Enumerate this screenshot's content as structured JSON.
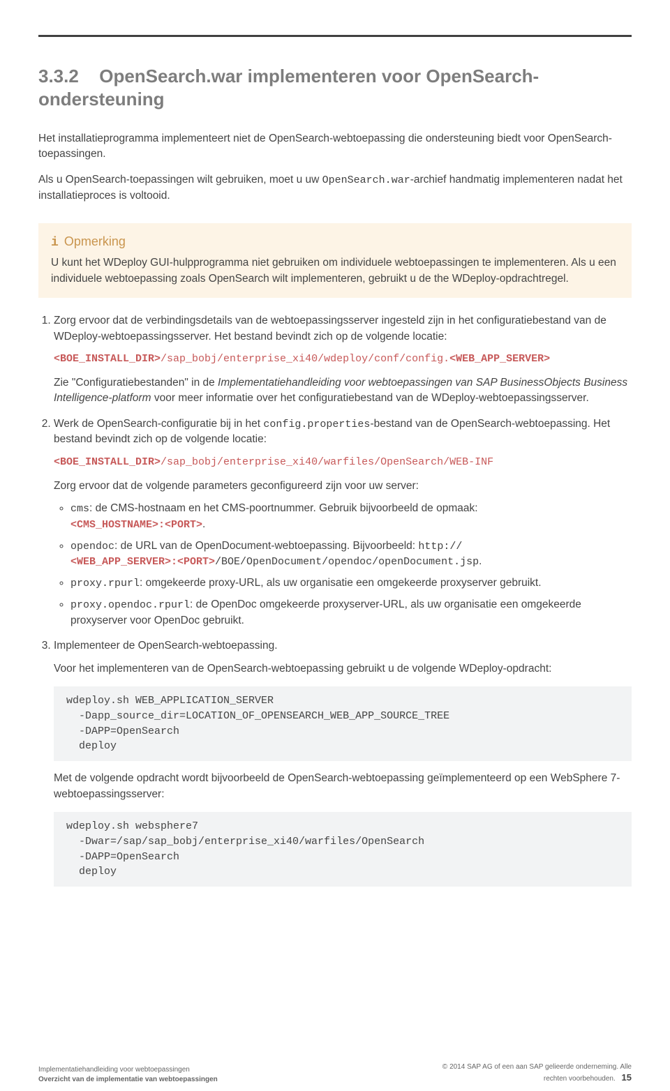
{
  "heading": {
    "number": "3.3.2",
    "title_line1": "OpenSearch.war implementeren voor OpenSearch-",
    "title_line2": "ondersteuning"
  },
  "intro_para": "Het installatieprogramma implementeert niet de OpenSearch-webtoepassing die ondersteuning biedt voor OpenSearch-toepassingen.",
  "para2_pre": "Als u OpenSearch-toepassingen wilt gebruiken, moet u uw ",
  "para2_code": "OpenSearch.war",
  "para2_post": "-archief handmatig implementeren nadat het installatieproces is voltooid.",
  "note": {
    "label": "Opmerking",
    "text": "U kunt het WDeploy GUI-hulpprogramma niet gebruiken om individuele webtoepassingen te implementeren. Als u een individuele webtoepassing zoals OpenSearch wilt implementeren, gebruikt u de the WDeploy-opdrachtregel."
  },
  "step1": {
    "text": "Zorg ervoor dat de verbindingsdetails van de webtoepassingsserver ingesteld zijn in het configuratiebestand van de WDeploy-webtoepassingsserver. Het bestand bevindt zich op de volgende locatie:",
    "path_var1": "<BOE_INSTALL_DIR>",
    "path_rest1": "/sap_bobj/enterprise_xi40/wdeploy/conf/config.",
    "path_var2": "<WEB_APP_SERVER>",
    "after_pre": "Zie \"Configuratiebestanden\" in de ",
    "after_italic": "Implementatiehandleiding voor webtoepassingen van SAP BusinessObjects Business Intelligence-platform",
    "after_post": " voor meer informatie over het configuratiebestand van de WDeploy-webtoepassingsserver."
  },
  "step2": {
    "pre": "Werk de OpenSearch-configuratie bij in het ",
    "code": "config.properties",
    "post": "-bestand van de OpenSearch-webtoepassing. Het bestand bevindt zich op de volgende locatie:",
    "path_var": "<BOE_INSTALL_DIR>",
    "path_rest": "/sap_bobj/enterprise_xi40/warfiles/OpenSearch/WEB-INF",
    "params_intro": "Zorg ervoor dat de volgende parameters geconfigureerd zijn voor uw server:",
    "bullets": {
      "cms": {
        "c": "cms",
        "t1": ": de CMS-hostnaam en het CMS-poortnummer. Gebruik bijvoorbeeld de opmaak: ",
        "t2": "<CMS_HOSTNAME>:<PORT>",
        "t3": "."
      },
      "opendoc": {
        "c": "opendoc",
        "t1": ": de URL van de OpenDocument-webtoepassing. Bijvoorbeeld: ",
        "t2": "http://",
        "t3": "<WEB_APP_SERVER>:<PORT>",
        "t4": "/BOE/OpenDocument/opendoc/openDocument.jsp",
        "t5": "."
      },
      "proxy": {
        "c": "proxy.rpurl",
        "t1": ": omgekeerde proxy-URL, als uw organisatie een omgekeerde proxyserver gebruikt."
      },
      "proxyopendoc": {
        "c": "proxy.opendoc.rpurl",
        "t1": ": de OpenDoc omgekeerde proxyserver-URL, als uw organisatie een omgekeerde proxyserver voor OpenDoc gebruikt."
      }
    }
  },
  "step3": {
    "title": "Implementeer de OpenSearch-webtoepassing.",
    "sub": "Voor het implementeren van de OpenSearch-webtoepassing gebruikt u de volgende WDeploy-opdracht:",
    "code1": "wdeploy.sh WEB_APPLICATION_SERVER\n  -Dapp_source_dir=LOCATION_OF_OPENSEARCH_WEB_APP_SOURCE_TREE\n  -DAPP=OpenSearch\n  deploy",
    "mid": "Met de volgende opdracht wordt bijvoorbeeld de OpenSearch-webtoepassing geïmplementeerd op een WebSphere 7-webtoepassingsserver:",
    "code2": "wdeploy.sh websphere7\n  -Dwar=/sap/sap_bobj/enterprise_xi40/warfiles/OpenSearch\n  -DAPP=OpenSearch\n  deploy"
  },
  "footer": {
    "left1": "Implementatiehandleiding voor webtoepassingen",
    "left2": "Overzicht van de implementatie van webtoepassingen",
    "right1": "2014 SAP AG of een aan SAP gelieerde onderneming. Alle",
    "right2": "rechten voorbehouden.",
    "page": "15"
  }
}
